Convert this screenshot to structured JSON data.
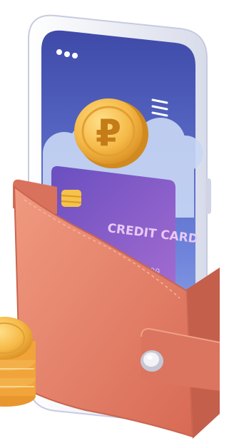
{
  "illustration": {
    "coin_symbol": "₽",
    "card_label": "CREDIT CARD",
    "card_digits": "0000"
  },
  "colors": {
    "phone_frame": "#eef0f7",
    "screen_top": "#4a57b5",
    "screen_bottom": "#8fa3e6",
    "cloud": "#c9d8f5",
    "coin": "#f2b640",
    "card": "#7a55b8",
    "wallet": "#e37f68",
    "wallet_shadow": "#c96550"
  }
}
